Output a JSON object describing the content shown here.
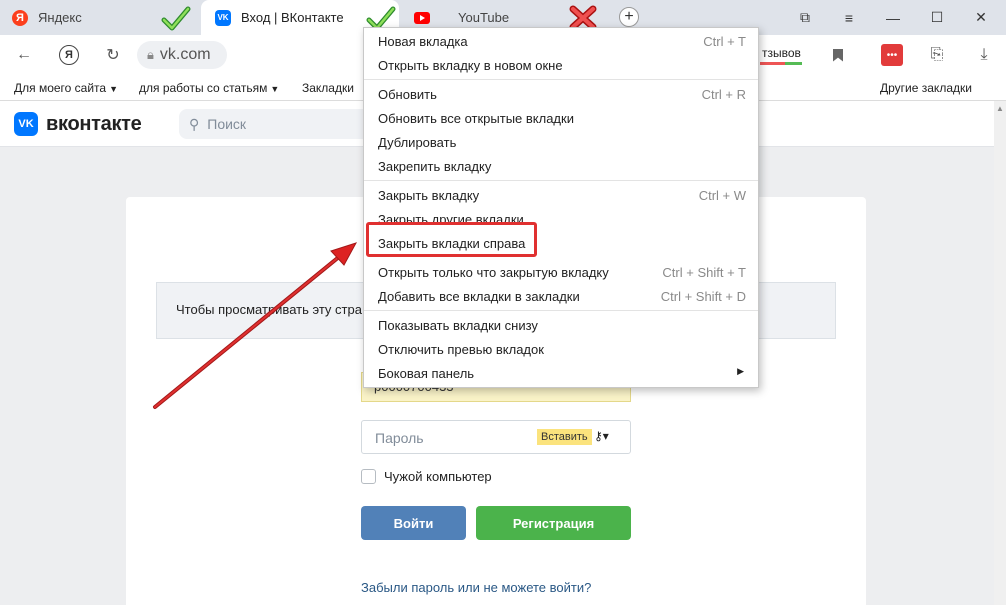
{
  "tabs": [
    {
      "label": "Яндекс",
      "favicon": "yandex-icon",
      "annotation": "green-check"
    },
    {
      "label": "Вход | ВКонтакте",
      "favicon": "vk-icon",
      "annotation": "green-check",
      "active": true
    },
    {
      "label": "YouTube",
      "favicon": "youtube-icon",
      "annotation": "red-cross"
    }
  ],
  "toolbar": {
    "address": "vk.com",
    "reviews_label": "тзывов"
  },
  "bookmarks": [
    {
      "label": "Для моего сайта"
    },
    {
      "label": "для работы со статьям"
    },
    {
      "label": "Закладки"
    },
    {
      "label": "Другие закладки"
    }
  ],
  "vk": {
    "logo_text": "вконтакте",
    "logo_mark": "VK",
    "search_placeholder": "Поиск",
    "notice_text": "Чтобы просматривать эту стра",
    "login_value": "p0000700433",
    "password_placeholder": "Пароль",
    "paste_label": "Вставить",
    "remember_label": "Чужой компьютер",
    "login_button": "Войти",
    "register_button": "Регистрация",
    "forgot_link": "Забыли пароль или не можете войти?"
  },
  "context_menu": {
    "items": [
      {
        "label": "Новая вкладка",
        "shortcut": "Ctrl + T"
      },
      {
        "label": "Открыть вкладку в новом окне",
        "shortcut": ""
      },
      {
        "label": "Обновить",
        "shortcut": "Ctrl + R"
      },
      {
        "label": "Обновить все открытые вкладки",
        "shortcut": ""
      },
      {
        "label": "Дублировать",
        "shortcut": ""
      },
      {
        "label": "Закрепить вкладку",
        "shortcut": ""
      },
      {
        "label": "Закрыть вкладку",
        "shortcut": "Ctrl + W"
      },
      {
        "label": "Закрыть другие вкладки",
        "shortcut": ""
      },
      {
        "label": "Закрыть вкладки справа",
        "shortcut": "",
        "highlighted": true
      },
      {
        "label": "Открыть только что закрытую вкладку",
        "shortcut": "Ctrl + Shift + T"
      },
      {
        "label": "Добавить все вкладки в закладки",
        "shortcut": "Ctrl + Shift + D"
      },
      {
        "label": "Показывать вкладки снизу",
        "shortcut": ""
      },
      {
        "label": "Отключить превью вкладок",
        "shortcut": ""
      },
      {
        "label": "Боковая панель",
        "shortcut": "",
        "submenu": true
      }
    ]
  },
  "colors": {
    "annotation_red": "#e03030",
    "vk_blue": "#0077ff",
    "login_button": "#5181b8",
    "register_button": "#4bb34b"
  }
}
